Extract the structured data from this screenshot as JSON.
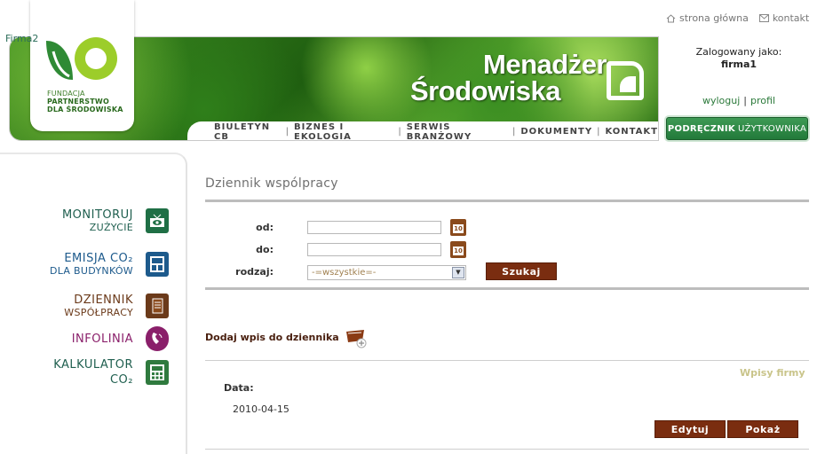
{
  "toplinks": {
    "home": "strona główna",
    "contact": "kontakt"
  },
  "logo": {
    "line1": "FUNDACJA",
    "line2": "PARTNERSTWO",
    "line3": "DLA ŚRODOWISKA"
  },
  "brand": {
    "line1": "Menadżer",
    "line2": "Środowiska"
  },
  "nav": {
    "items": [
      "BIULETYN CB",
      "BIZNES I EKOLOGIA",
      "SERWIS BRANŻOWY",
      "DOKUMENTY",
      "KONTAKT"
    ],
    "sep": "|"
  },
  "user": {
    "logged_as": "Zalogowany jako:",
    "name": "firma1",
    "logout": "wyloguj",
    "pipe": "|",
    "profile": "profil"
  },
  "manual": {
    "bold": "PODRĘCZNIK",
    "rest": "UŻYTKOWNIKA"
  },
  "sidebar": {
    "company": "Firma2",
    "items": [
      {
        "line1": "MONITORUJ",
        "line2": "ZUŻYCIE",
        "icon": "tv-eye-icon"
      },
      {
        "line1": "EMISJA CO₂",
        "line2": "DLA BUDYNKÓW",
        "icon": "co2-building-icon"
      },
      {
        "line1": "DZIENNIK",
        "line2": "WSPÓŁPRACY",
        "icon": "notebook-icon"
      },
      {
        "line1": "INFOLINIA",
        "line2": "",
        "icon": "phone-icon"
      },
      {
        "line1": "KALKULATOR",
        "line2": "CO₂",
        "icon": "co2-calculator-icon"
      }
    ]
  },
  "main": {
    "title": "Dziennik wspólpracy",
    "form": {
      "from_label": "od:",
      "to_label": "do:",
      "type_label": "rodzaj:",
      "from_value": "",
      "to_value": "",
      "type_selected": "-=wszystkie=-",
      "search_button": "Szukaj"
    },
    "add_entry": "Dodaj wpis do dziennika",
    "company_entries": "Wpisy firmy",
    "entry": {
      "date_label": "Data:",
      "date_value": "2010-04-15",
      "edit_button": "Edytuj",
      "show_button": "Pokaż"
    }
  },
  "colors": {
    "brand_green": "#227a3a",
    "button_brown": "#7a2d10",
    "link_green": "#2c7a3b"
  }
}
